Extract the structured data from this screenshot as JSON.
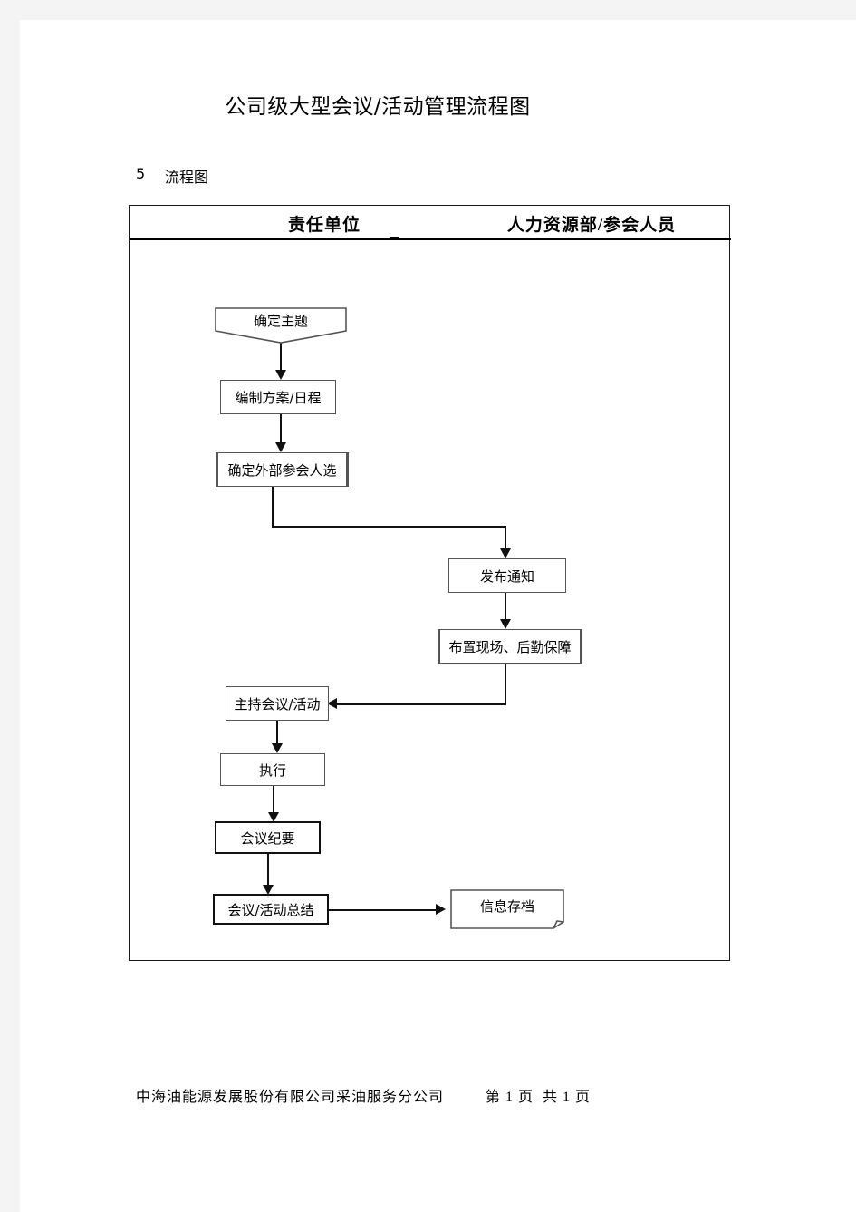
{
  "document": {
    "title": "公司级大型会议/活动管理流程图",
    "section_number": "5",
    "section_label": "流程图"
  },
  "flowchart": {
    "columns": [
      {
        "id": "responsible-unit",
        "label": "责任单位"
      },
      {
        "id": "hr-participants",
        "label": "人力资源部/参会人员"
      }
    ],
    "nodes": [
      {
        "id": "n1",
        "label": "确定主题",
        "shape": "banner",
        "column": "responsible-unit"
      },
      {
        "id": "n2",
        "label": "编制方案/日程",
        "shape": "process",
        "column": "responsible-unit"
      },
      {
        "id": "n3",
        "label": "确定外部参会人选",
        "shape": "process",
        "column": "responsible-unit"
      },
      {
        "id": "n4",
        "label": "发布通知",
        "shape": "process",
        "column": "hr-participants"
      },
      {
        "id": "n5",
        "label": "布置现场、后勤保障",
        "shape": "process",
        "column": "hr-participants"
      },
      {
        "id": "n6",
        "label": "主持会议/活动",
        "shape": "process",
        "column": "responsible-unit"
      },
      {
        "id": "n7",
        "label": "执行",
        "shape": "process",
        "column": "responsible-unit"
      },
      {
        "id": "n8",
        "label": "会议纪要",
        "shape": "process",
        "column": "responsible-unit"
      },
      {
        "id": "n9",
        "label": "会议/活动总结",
        "shape": "process",
        "column": "responsible-unit"
      },
      {
        "id": "n10",
        "label": "信息存档",
        "shape": "document",
        "column": "hr-participants"
      }
    ],
    "edges": [
      {
        "from": "n1",
        "to": "n2",
        "type": "down"
      },
      {
        "from": "n2",
        "to": "n3",
        "type": "down"
      },
      {
        "from": "n3",
        "to": "n4",
        "type": "down-right-down"
      },
      {
        "from": "n4",
        "to": "n5",
        "type": "down"
      },
      {
        "from": "n5",
        "to": "n6",
        "type": "down-left"
      },
      {
        "from": "n6",
        "to": "n7",
        "type": "down"
      },
      {
        "from": "n7",
        "to": "n8",
        "type": "down"
      },
      {
        "from": "n8",
        "to": "n9",
        "type": "down"
      },
      {
        "from": "n9",
        "to": "n10",
        "type": "right"
      }
    ]
  },
  "footer": {
    "company": "中海油能源发展股份有限公司采油服务分公司",
    "page_info": "第 1 页  共 1 页"
  },
  "colors": {
    "page_background": "#ffffff",
    "surround": "#f4f4f4",
    "line": "#111111",
    "text": "#000000",
    "box_border": "#555555"
  }
}
